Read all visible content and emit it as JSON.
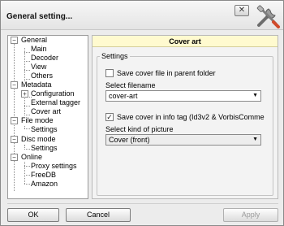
{
  "window": {
    "title": "General setting...",
    "close_symbol": "✕",
    "app_icon": "tools-icon"
  },
  "tree": {
    "toggle_symbol": "−",
    "expand_symbol": "+",
    "items": [
      {
        "label": "General"
      },
      {
        "label": "Main"
      },
      {
        "label": "Decoder"
      },
      {
        "label": "View"
      },
      {
        "label": "Others"
      },
      {
        "label": "Metadata"
      },
      {
        "label": "Configuration"
      },
      {
        "label": "External tagger"
      },
      {
        "label": "Cover art"
      },
      {
        "label": "File mode"
      },
      {
        "label": "Settings"
      },
      {
        "label": "Disc mode"
      },
      {
        "label": "Settings"
      },
      {
        "label": "Online"
      },
      {
        "label": "Proxy settings"
      },
      {
        "label": "FreeDB"
      },
      {
        "label": "Amazon"
      }
    ]
  },
  "panel": {
    "header": "Cover art",
    "group_label": "Settings",
    "save_parent_label": "Save cover file in parent folder",
    "save_parent_checked": false,
    "select_filename_label": "Select filename",
    "filename_value": "cover-art",
    "save_in_tag_label": "Save cover in info tag (Id3v2 & VorbisComme",
    "save_in_tag_checked": true,
    "check_symbol": "✓",
    "select_picture_label": "Select kind of picture",
    "picture_value": "Cover (front)",
    "dropdown_arrow": "▼"
  },
  "buttons": {
    "ok": "OK",
    "cancel": "Cancel",
    "apply": "Apply"
  }
}
